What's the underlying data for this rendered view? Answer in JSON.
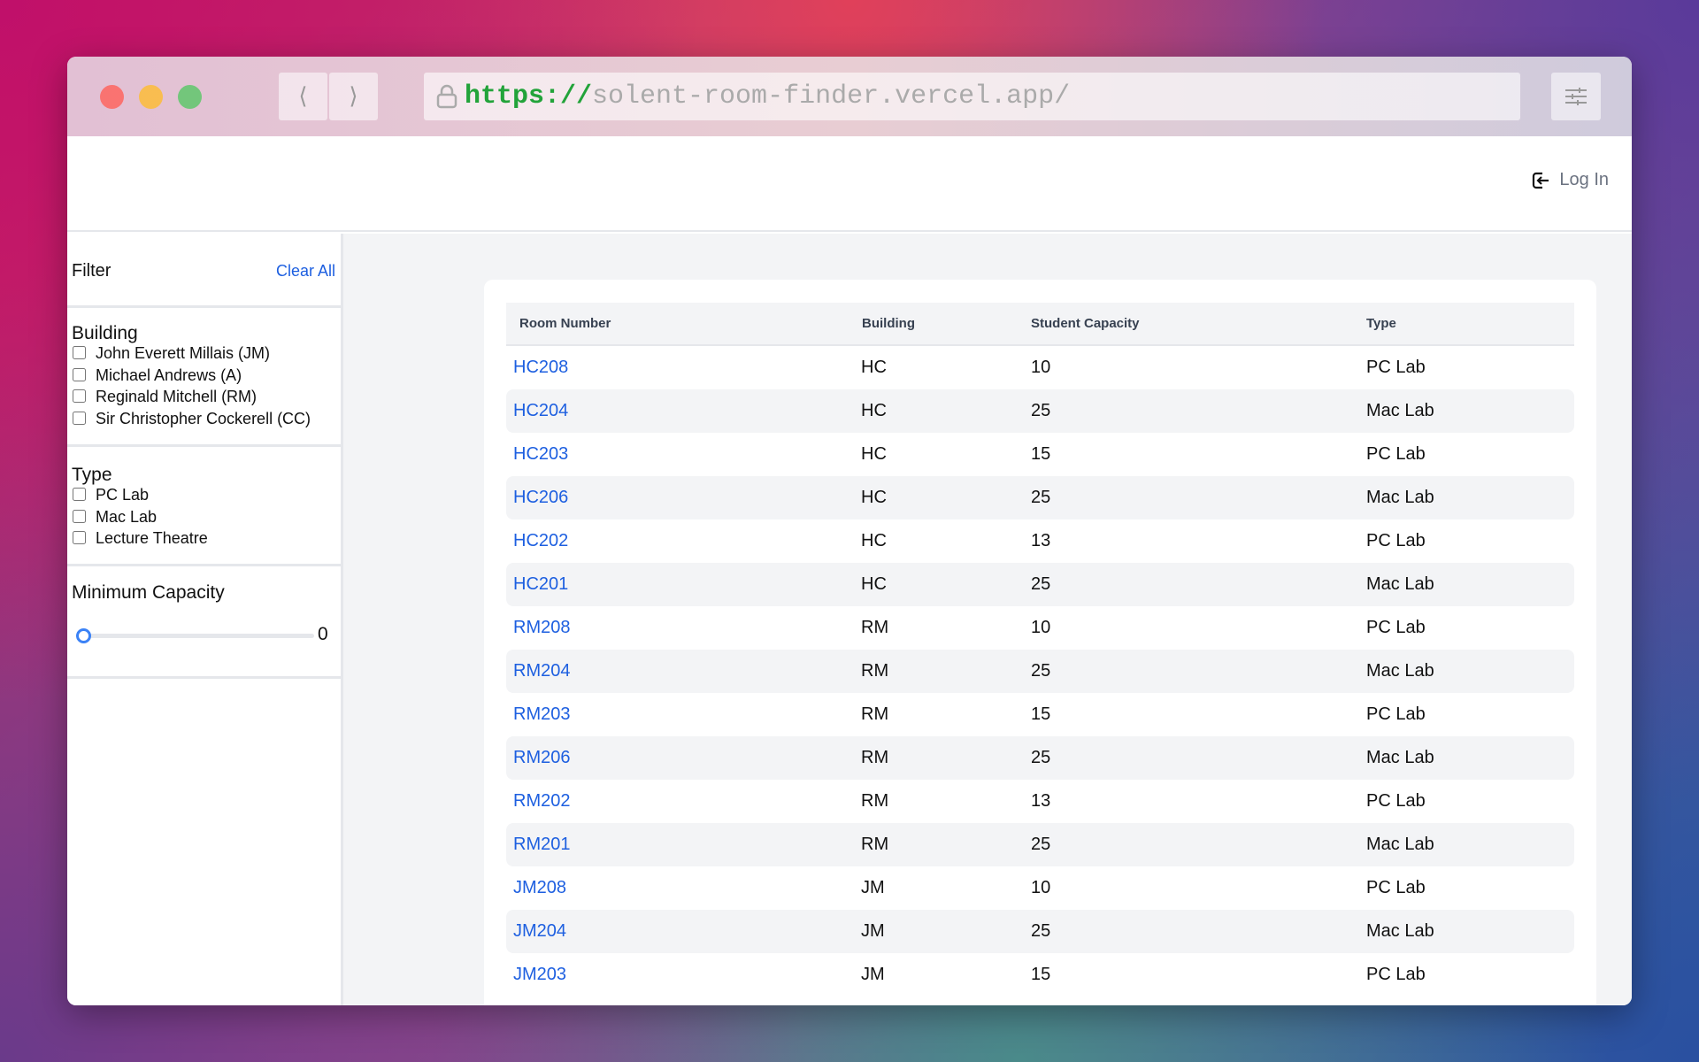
{
  "browser": {
    "url_scheme": "https://",
    "url_rest": "solent-room-finder.vercel.app/"
  },
  "header": {
    "login_label": "Log In"
  },
  "sidebar": {
    "title": "Filter",
    "clear_all": "Clear All",
    "building": {
      "heading": "Building",
      "options": [
        "John Everett Millais (JM)",
        "Michael Andrews (A)",
        "Reginald Mitchell (RM)",
        "Sir Christopher Cockerell (CC)"
      ]
    },
    "type": {
      "heading": "Type",
      "options": [
        "PC Lab",
        "Mac Lab",
        "Lecture Theatre"
      ]
    },
    "capacity": {
      "heading": "Minimum Capacity",
      "value": "0"
    }
  },
  "table": {
    "headers": [
      "Room Number",
      "Building",
      "Student Capacity",
      "Type"
    ],
    "rows": [
      [
        "HC208",
        "HC",
        "10",
        "PC Lab"
      ],
      [
        "HC204",
        "HC",
        "25",
        "Mac Lab"
      ],
      [
        "HC203",
        "HC",
        "15",
        "PC Lab"
      ],
      [
        "HC206",
        "HC",
        "25",
        "Mac Lab"
      ],
      [
        "HC202",
        "HC",
        "13",
        "PC Lab"
      ],
      [
        "HC201",
        "HC",
        "25",
        "Mac Lab"
      ],
      [
        "RM208",
        "RM",
        "10",
        "PC Lab"
      ],
      [
        "RM204",
        "RM",
        "25",
        "Mac Lab"
      ],
      [
        "RM203",
        "RM",
        "15",
        "PC Lab"
      ],
      [
        "RM206",
        "RM",
        "25",
        "Mac Lab"
      ],
      [
        "RM202",
        "RM",
        "13",
        "PC Lab"
      ],
      [
        "RM201",
        "RM",
        "25",
        "Mac Lab"
      ],
      [
        "JM208",
        "JM",
        "10",
        "PC Lab"
      ],
      [
        "JM204",
        "JM",
        "25",
        "Mac Lab"
      ],
      [
        "JM203",
        "JM",
        "15",
        "PC Lab"
      ]
    ]
  }
}
